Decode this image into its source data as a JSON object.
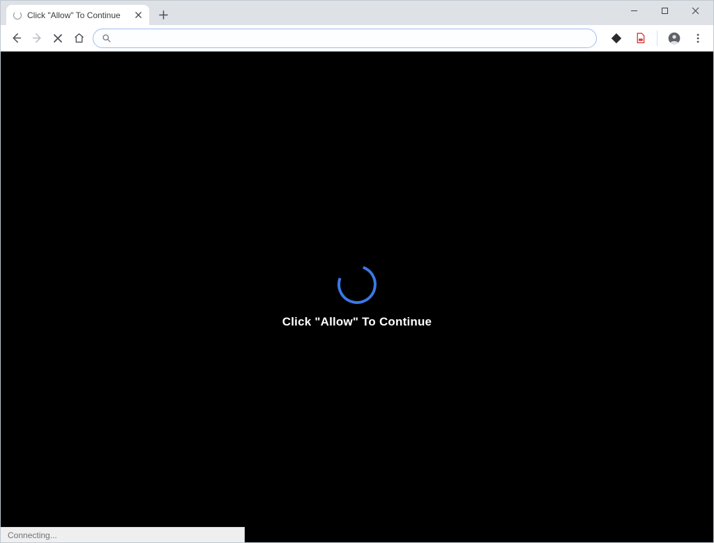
{
  "tab": {
    "title": "Click \"Allow\" To Continue",
    "loading": true
  },
  "address_bar": {
    "value": "",
    "placeholder": ""
  },
  "page": {
    "message": "Click \"Allow\" To Continue"
  },
  "status": {
    "text": "Connecting..."
  },
  "icons": {
    "tab_loading": "loading-spinner-icon",
    "tab_close": "close-icon",
    "new_tab": "plus-icon",
    "win_min": "minimize-icon",
    "win_max": "maximize-icon",
    "win_close": "close-icon",
    "nav_back": "arrow-left-icon",
    "nav_forward": "arrow-right-icon",
    "nav_stop": "close-icon",
    "nav_home": "home-icon",
    "omnibox_search": "search-icon",
    "ext_1": "diamond-icon",
    "ext_2": "document-red-icon",
    "profile": "user-circle-icon",
    "menu": "kebab-menu-icon"
  }
}
